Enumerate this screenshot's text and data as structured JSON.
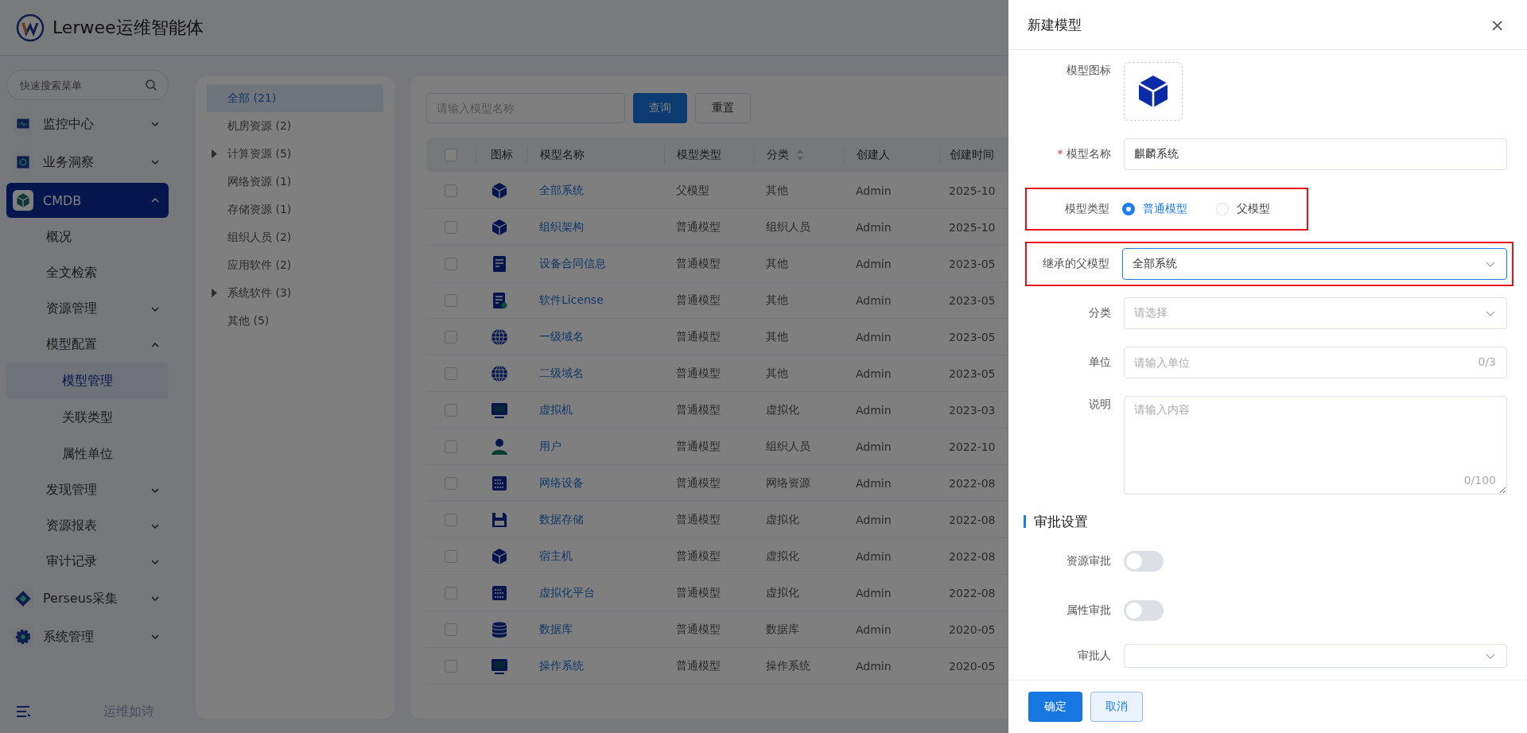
{
  "header": {
    "brand": "Lerwee运维智能体"
  },
  "sidebar": {
    "search": {
      "placeholder": "快速搜索菜单"
    },
    "items": [
      {
        "label": "监控中心",
        "kind": "monitor",
        "expanded": false,
        "selected": false
      },
      {
        "label": "业务洞察",
        "kind": "insight",
        "expanded": false,
        "selected": false
      },
      {
        "label": "CMDB",
        "kind": "cube",
        "expanded": true,
        "selected": true,
        "children": [
          {
            "label": "概况",
            "selected": false
          },
          {
            "label": "全文检索",
            "selected": false
          },
          {
            "label": "资源管理",
            "expanded": false,
            "selected": false
          },
          {
            "label": "模型配置",
            "expanded": true,
            "selected": false,
            "children": [
              {
                "label": "模型管理",
                "selected": true
              },
              {
                "label": "关联类型",
                "selected": false
              },
              {
                "label": "属性单位",
                "selected": false
              }
            ]
          },
          {
            "label": "发现管理",
            "expanded": false,
            "selected": false
          },
          {
            "label": "资源报表",
            "expanded": false,
            "selected": false
          },
          {
            "label": "审计记录",
            "expanded": false,
            "selected": false
          }
        ]
      },
      {
        "label": "Perseus采集",
        "kind": "diamond",
        "expanded": false,
        "selected": false
      },
      {
        "label": "系统管理",
        "kind": "gear",
        "expanded": false,
        "selected": false
      }
    ],
    "footer": "运维如诗"
  },
  "categories": [
    {
      "label": "全部 (21)",
      "selected": true,
      "expandable": false
    },
    {
      "label": "机房资源 (2)",
      "selected": false,
      "expandable": false
    },
    {
      "label": "计算资源 (5)",
      "selected": false,
      "expandable": true
    },
    {
      "label": "网络资源 (1)",
      "selected": false,
      "expandable": false
    },
    {
      "label": "存储资源 (1)",
      "selected": false,
      "expandable": false
    },
    {
      "label": "组织人员 (2)",
      "selected": false,
      "expandable": false
    },
    {
      "label": "应用软件 (2)",
      "selected": false,
      "expandable": false
    },
    {
      "label": "系统软件 (3)",
      "selected": false,
      "expandable": true
    },
    {
      "label": "其他 (5)",
      "selected": false,
      "expandable": false
    }
  ],
  "toolbar": {
    "search": {
      "placeholder": "请输入模型名称"
    },
    "query": "查询",
    "reset": "重置"
  },
  "table": {
    "select_all_checked": false,
    "columns": [
      "图标",
      "模型名称",
      "模型类型",
      "分类",
      "创建人",
      "创建时间"
    ],
    "rows": [
      {
        "checked": false,
        "kind": "cube",
        "name": "全部系统",
        "type": "父模型",
        "category": "其他",
        "creator": "Admin",
        "created": "2025-10"
      },
      {
        "checked": false,
        "kind": "cube",
        "name": "组织架构",
        "type": "普通模型",
        "category": "组织人员",
        "creator": "Admin",
        "created": "2025-10"
      },
      {
        "checked": false,
        "kind": "document",
        "name": "设备合同信息",
        "type": "普通模型",
        "category": "其他",
        "creator": "Admin",
        "created": "2023-05"
      },
      {
        "checked": false,
        "kind": "certificate",
        "name": "软件License",
        "type": "普通模型",
        "category": "其他",
        "creator": "Admin",
        "created": "2023-05"
      },
      {
        "checked": false,
        "kind": "globe",
        "name": "一级域名",
        "type": "普通模型",
        "category": "其他",
        "creator": "Admin",
        "created": "2023-05"
      },
      {
        "checked": false,
        "kind": "globe",
        "name": "二级域名",
        "type": "普通模型",
        "category": "其他",
        "creator": "Admin",
        "created": "2023-05"
      },
      {
        "checked": false,
        "kind": "monitor",
        "name": "虚拟机",
        "type": "普通模型",
        "category": "虚拟化",
        "creator": "Admin",
        "created": "2023-03"
      },
      {
        "checked": false,
        "kind": "user",
        "name": "用户",
        "type": "普通模型",
        "category": "组织人员",
        "creator": "Admin",
        "created": "2022-10"
      },
      {
        "checked": false,
        "kind": "server",
        "name": "网络设备",
        "type": "普通模型",
        "category": "网络资源",
        "creator": "Admin",
        "created": "2022-08"
      },
      {
        "checked": false,
        "kind": "floppy",
        "name": "数据存储",
        "type": "普通模型",
        "category": "虚拟化",
        "creator": "Admin",
        "created": "2022-08"
      },
      {
        "checked": false,
        "kind": "cube",
        "name": "宿主机",
        "type": "普通模型",
        "category": "虚拟化",
        "creator": "Admin",
        "created": "2022-08"
      },
      {
        "checked": false,
        "kind": "server",
        "name": "虚拟化平台",
        "type": "普通模型",
        "category": "虚拟化",
        "creator": "Admin",
        "created": "2022-08"
      },
      {
        "checked": false,
        "kind": "database",
        "name": "数据库",
        "type": "普通模型",
        "category": "数据库",
        "creator": "Admin",
        "created": "2020-05"
      },
      {
        "checked": false,
        "kind": "monitor",
        "name": "操作系统",
        "type": "普通模型",
        "category": "操作系统",
        "creator": "Admin",
        "created": "2020-05"
      }
    ]
  },
  "drawer": {
    "title": "新建模型",
    "close": "×",
    "icon_label": "模型图标",
    "name": {
      "label": "模型名称",
      "required_mark": "*",
      "value": "麒麟系统"
    },
    "type": {
      "label": "模型类型",
      "highlighted": true,
      "options": [
        {
          "label": "普通模型",
          "selected": true
        },
        {
          "label": "父模型",
          "selected": false
        }
      ]
    },
    "parent": {
      "label": "继承的父模型",
      "highlighted": true,
      "focused": true,
      "value": "全部系统"
    },
    "category": {
      "label": "分类",
      "placeholder": "请选择"
    },
    "unit": {
      "label": "单位",
      "placeholder": "请输入单位",
      "counter": "0/3"
    },
    "description": {
      "label": "说明",
      "placeholder": "请输入内容",
      "counter": "0/100"
    },
    "approval": {
      "title": "审批设置",
      "switches": [
        {
          "label": "资源审批",
          "on": false
        },
        {
          "label": "属性审批",
          "on": false
        }
      ],
      "approver": {
        "label": "审批人"
      }
    },
    "confirm": "确定",
    "cancel": "取消"
  }
}
